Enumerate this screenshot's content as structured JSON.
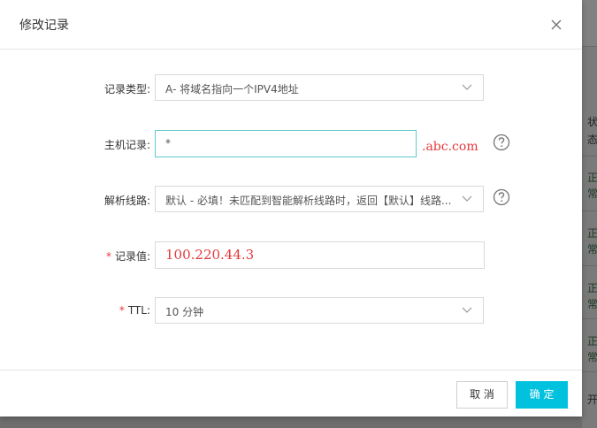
{
  "modal": {
    "title": "修改记录"
  },
  "form": {
    "record_type": {
      "label": "记录类型:",
      "value": "A- 将域名指向一个IPV4地址"
    },
    "host": {
      "label": "主机记录:",
      "value": "*",
      "suffix": ".abc.com"
    },
    "line": {
      "label": "解析线路:",
      "value": "默认 - 必填！未匹配到智能解析线路时，返回【默认】线路..."
    },
    "record_value": {
      "label": "记录值:",
      "value": "100.220.44.3",
      "required_mark": "*"
    },
    "ttl": {
      "label": "TTL:",
      "value": "10 分钟",
      "required_mark": "*"
    }
  },
  "footer": {
    "cancel_label": "取 消",
    "ok_label": "确 定"
  },
  "background": {
    "fragments": [
      "状",
      "态",
      "正",
      "常",
      "正",
      "常",
      "正",
      "常",
      "正",
      "常",
      "开"
    ]
  },
  "colors": {
    "accent": "#00c1de",
    "focus_border": "#5ec9cf",
    "required": "#e4393c"
  }
}
